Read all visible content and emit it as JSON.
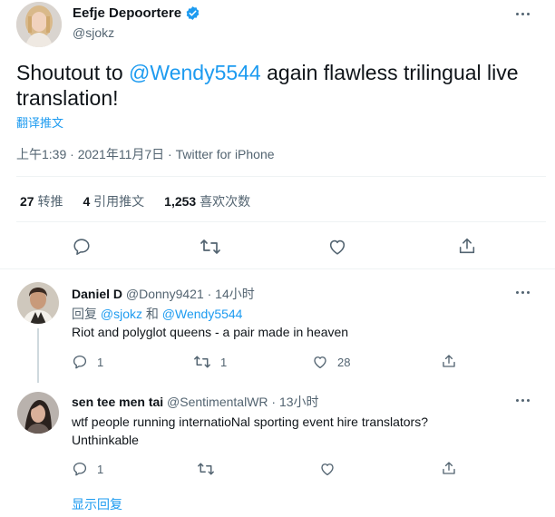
{
  "main_tweet": {
    "author_name": "Eefje Depoortere",
    "author_handle": "@sjokz",
    "text_before": "Shoutout to ",
    "mention": "@Wendy5544",
    "text_after": " again flawless trilingual live translation!",
    "translate_label": "翻译推文",
    "meta": "上午1:39 · 2021年11月7日 · Twitter for iPhone",
    "stats": {
      "retweets_count": "27",
      "retweets_label": "转推",
      "quotes_count": "4",
      "quotes_label": "引用推文",
      "likes_count": "1,253",
      "likes_label": "喜欢次数"
    },
    "verified_color": "#1d9bf0"
  },
  "replies": [
    {
      "name": "Daniel D",
      "handle": "@Donny9421",
      "time": " · 14小时",
      "reply_prefix": "回复 ",
      "reply_to_1": "@sjokz",
      "reply_and": " 和 ",
      "reply_to_2": "@Wendy5544",
      "text": "Riot and polyglot queens - a pair made in heaven",
      "reply_count": "1",
      "retweet_count": "1",
      "like_count": "28"
    },
    {
      "name": "sen tee men tai",
      "handle": "@SentimentalWR",
      "time": " · 13小时",
      "text_line1": "wtf people running internatioNal sporting event hire translators?",
      "text_line2": "Unthinkable",
      "reply_count": "1"
    }
  ],
  "show_replies_label": "显示回复",
  "icons": {
    "verified": "verified-badge-icon",
    "more": "more-dots-icon",
    "reply": "reply-bubble-icon",
    "retweet": "retweet-icon",
    "like": "heart-icon",
    "share": "share-icon"
  },
  "colors": {
    "accent": "#1d9bf0",
    "text": "#0f1419",
    "muted": "#536471"
  }
}
